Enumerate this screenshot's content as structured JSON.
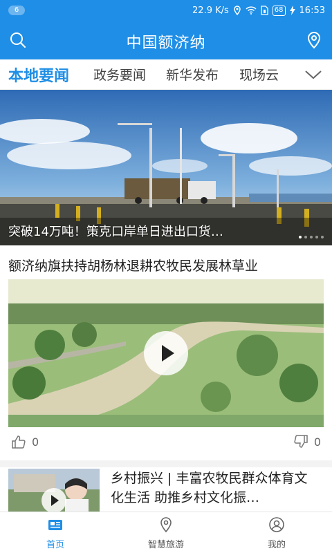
{
  "status_bar": {
    "notification_count": "6",
    "network_speed": "22.9 K/s",
    "battery": "68",
    "time": "16:53",
    "icons": [
      "location-icon",
      "wifi-icon",
      "sim-icon",
      "battery-icon",
      "charging-icon"
    ]
  },
  "header": {
    "title": "中国额济纳",
    "left_icon": "search-icon",
    "right_icon": "location-pin-icon",
    "color": "#1f8ee6"
  },
  "tabs": [
    {
      "label": "本地要闻",
      "active": true
    },
    {
      "label": "政务要闻",
      "active": false
    },
    {
      "label": "新华发布",
      "active": false
    },
    {
      "label": "现场云",
      "active": false
    }
  ],
  "tabs_more_icon": "chevron-down-icon",
  "banner": {
    "caption": "突破14万吨！策克口岸单日进出口货…"
  },
  "article1": {
    "title": "额济纳旗扶持胡杨林退耕农牧民发展林草业",
    "likes": "0",
    "dislikes": "0"
  },
  "article2": {
    "title": "乡村振兴 | 丰富农牧民群众体育文化生活 助推乡村文化振…"
  },
  "bottom_nav": [
    {
      "label": "首页",
      "icon": "news-icon",
      "active": true
    },
    {
      "label": "智慧旅游",
      "icon": "location-icon",
      "active": false
    },
    {
      "label": "我的",
      "icon": "user-icon",
      "active": false
    }
  ],
  "accent_color": "#1f8ee6"
}
